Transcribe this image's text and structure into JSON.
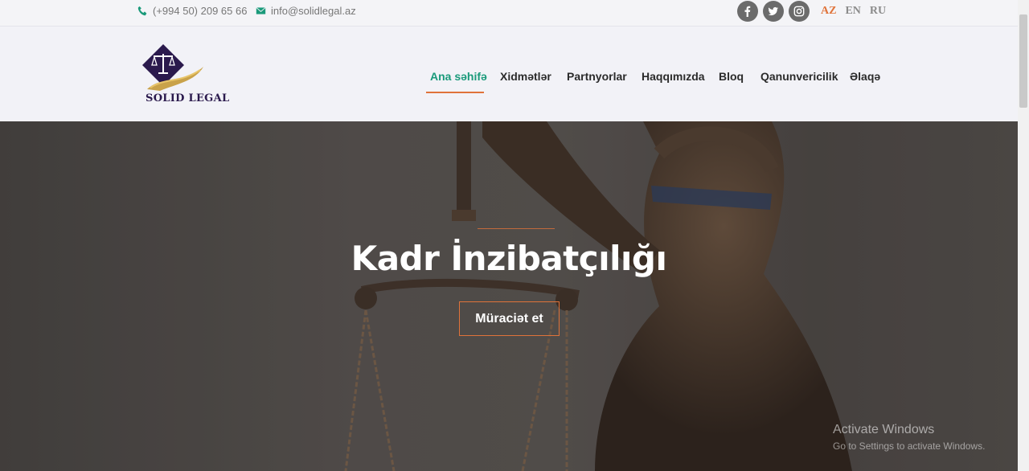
{
  "topbar": {
    "phone": "(+994 50) 209 65 66",
    "email": "info@solidlegal.az",
    "social": [
      {
        "icon": "facebook-icon"
      },
      {
        "icon": "twitter-icon"
      },
      {
        "icon": "instagram-icon"
      }
    ],
    "languages": [
      "AZ",
      "EN",
      "RU"
    ],
    "active_language": "AZ"
  },
  "header": {
    "logo_text": "SOLID LEGAL",
    "nav": [
      "Ana səhifə",
      "Xidmətlər",
      "Partnyorlar",
      "Haqqımızda",
      "Bloq",
      "Qanunvericilik",
      "Əlaqə"
    ],
    "active_nav": "Ana səhifə"
  },
  "hero": {
    "title": "Kadr İnzibatçılığı",
    "button_label": "Müraciət et"
  },
  "watermark": {
    "line1": "Activate Windows",
    "line2": "Go to Settings to activate Windows."
  },
  "colors": {
    "accent": "#e0733a",
    "nav_active": "#1a9a7a",
    "logo_purple": "#2b1a4d",
    "logo_gold": "#c9a24a"
  }
}
